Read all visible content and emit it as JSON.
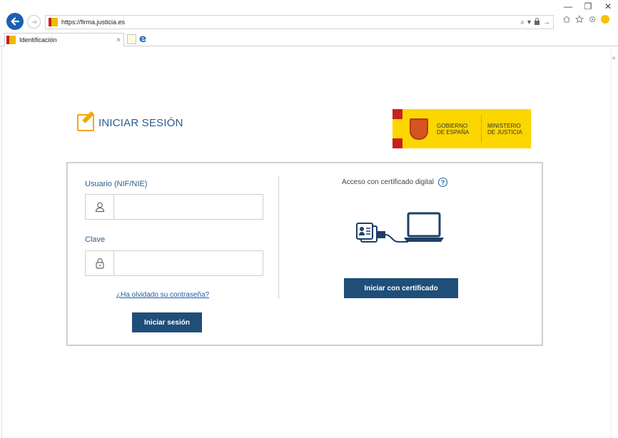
{
  "browser": {
    "url": "https://firma.justicia.es",
    "tab_title": "Identificación",
    "tab_close": "×",
    "window_controls": {
      "minimize": "—",
      "restore": "❐",
      "close": "✕"
    },
    "addr_tools": {
      "search": "⌕",
      "dropdown": "▾",
      "lock": "🔒",
      "go": "→"
    },
    "icons": [
      "home-icon",
      "star-icon",
      "gear-icon",
      "smiley-icon"
    ]
  },
  "header": {
    "title": "INICIAR SESIÓN",
    "logo": {
      "gobierno_line1": "GOBIERNO",
      "gobierno_line2": "DE ESPAÑA",
      "ministerio_line1": "MINISTERIO",
      "ministerio_line2": "DE JUSTICIA",
      "colors": {
        "yellow": "#fcd600",
        "red": "#c8201e"
      }
    }
  },
  "login": {
    "user_label": "Usuario (NIF/NIE)",
    "user_value": "",
    "password_label": "Clave",
    "password_value": "",
    "forgot_link": "¿Ha olvidado su contraseña?",
    "submit_label": "Iniciar sesión"
  },
  "certificate": {
    "title": "Acceso con certificado digital",
    "help": "?",
    "button_label": "Iniciar con certificado"
  },
  "colors": {
    "primary_button": "#1f4e79",
    "label_blue": "#2a5d8f",
    "accent_orange": "#f2a900"
  }
}
